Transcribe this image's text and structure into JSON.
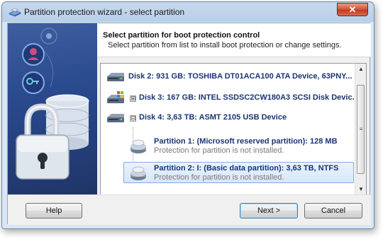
{
  "window": {
    "title": "Partition protection wizard - select partition",
    "close_glyph": "✕"
  },
  "header": {
    "title": "Select partition for boot protection control",
    "subtitle": "Select partition from list to install boot protection or change settings."
  },
  "tree": {
    "disks": [
      {
        "label": "Disk 2: 931 GB: TOSHIBA DT01ACA100 ATA Device, 63PNY...",
        "icon": "hard-disk-icon",
        "expander": ""
      },
      {
        "label": "Disk 3: 167 GB: INTEL SSDSC2CW180A3 SCSI Disk Devic...",
        "icon": "windows-disk-icon",
        "expander": "⊞"
      },
      {
        "label": "Disk 4: 3,63 TB: ASMT 2105 USB Device",
        "icon": "usb-disk-icon",
        "expander": "⊟"
      }
    ],
    "partitions": [
      {
        "label": "Partition 1: (Microsoft reserved partition): 128 MB",
        "status": "Protection for partition is not installed.",
        "selected": false,
        "icon": "partition-icon"
      },
      {
        "label": "Partition 2: I: (Basic data partition): 3,63 TB, NTFS",
        "status": "Protection for partition is not installed.",
        "selected": true,
        "icon": "partition-icon"
      }
    ]
  },
  "scrollbar": {
    "up_glyph": "▲",
    "down_glyph": "▼",
    "grip_glyph": "≡"
  },
  "buttons": {
    "help": "Help",
    "next": "Next >",
    "cancel": "Cancel"
  },
  "colors": {
    "accent": "#1a3573",
    "selection": "#d6e7fb",
    "close": "#c13b22"
  }
}
